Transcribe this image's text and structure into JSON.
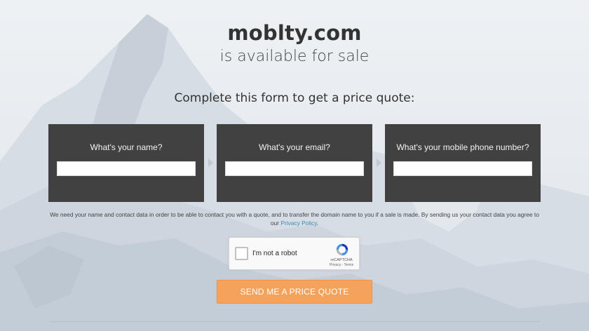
{
  "header": {
    "domain": "moblty.com",
    "subtitle": "is available for sale"
  },
  "form": {
    "heading": "Complete this form to get a price quote:",
    "fields": [
      {
        "label": "What's your name?",
        "value": ""
      },
      {
        "label": "What's your email?",
        "value": ""
      },
      {
        "label": "What's your mobile phone number?",
        "value": ""
      }
    ],
    "disclaimer_text": "We need your name and contact data in order to be able to contact you with a quote, and to transfer the domain name to you if a sale is made. By sending us your contact data you agree to our",
    "privacy_link": "Privacy Policy",
    "disclaimer_end": ".",
    "submit_label": "SEND ME A PRICE QUOTE"
  },
  "captcha": {
    "label": "I'm not a robot",
    "brand": "reCAPTCHA",
    "terms": "Privacy - Terms",
    "checked": false
  },
  "colors": {
    "field_box": "#414141",
    "submit": "#f5a35a",
    "link": "#3c8bb0"
  },
  "icons": [
    "chevron-right-icon",
    "recaptcha-logo-icon"
  ]
}
